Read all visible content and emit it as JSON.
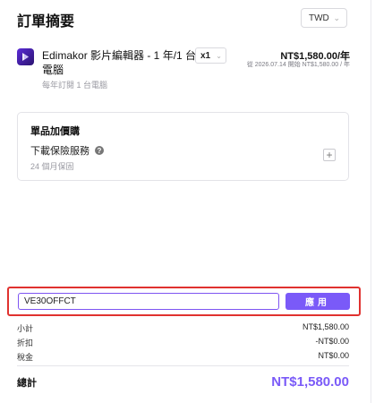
{
  "header": {
    "title": "訂單摘要",
    "currency": "TWD"
  },
  "product": {
    "name": "Edimakor 影片編輯器 - 1 年/1 台電腦",
    "subtitle": "每年訂閱 1 台電腦",
    "quantity": "x1",
    "price": "NT$1,580.00/年",
    "renewal_note": "從 2026.07.14 開始 NT$1,580.00 / 年"
  },
  "addon": {
    "title": "單品加價購",
    "item": "下載保險服務",
    "item_sub": "24 個月保固"
  },
  "coupon": {
    "value": "VE30OFFCT",
    "apply_label": "應用"
  },
  "summary": {
    "subtotal_label": "小計",
    "subtotal": "NT$1,580.00",
    "discount_label": "折扣",
    "discount": "-NT$0.00",
    "tax_label": "稅金",
    "tax": "NT$0.00",
    "total_label": "總計",
    "total": "NT$1,580.00"
  },
  "colors": {
    "accent": "#7a5af8",
    "highlight_border": "#e0322f"
  }
}
